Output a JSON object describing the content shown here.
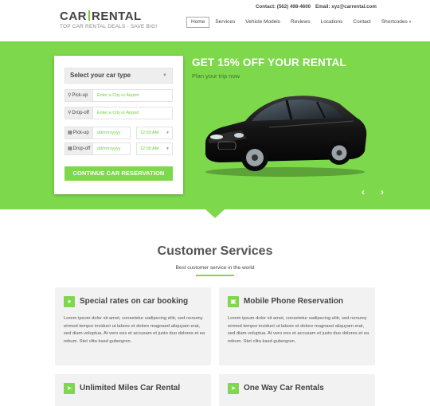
{
  "brand": {
    "logo_left": "CAR",
    "logo_right": "RENTAL",
    "tagline": "TOP CAR RENTAL DEALS - SAVE BIG!"
  },
  "contact": {
    "phone": "Contact: (562) 498-4600",
    "email": "Email: xyz@carrental.com"
  },
  "nav": {
    "items": [
      "Home",
      "Services",
      "Vehicle Models",
      "Reviews",
      "Locations",
      "Contact",
      "Shortcodes"
    ],
    "active": "Home"
  },
  "form": {
    "select_type": "Select your car type",
    "pickup_label": "Pick-up",
    "dropoff_label": "Drop-off",
    "pickup_location_placeholder": "Enter a City or Airport",
    "dropoff_location_placeholder": "Enter a City or Airport",
    "pickup_date_placeholder": "dd/mm/yyyy",
    "dropoff_date_placeholder": "dd/mm/yyyy",
    "pickup_time": "12:00 AM",
    "dropoff_time": "12:00 AM",
    "submit": "CONTINUE CAR RESERVATION"
  },
  "promo": {
    "title": "GET 15% OFF YOUR RENTAL",
    "subtitle": "Plan your trip now"
  },
  "services": {
    "title": "Customer Services",
    "subtitle": "Best customer service in the world",
    "cards": [
      {
        "title": "Special rates on car booking",
        "icon": "apple-icon",
        "text": "Lorem ipsum dolor sit amet, consetetur sadipscing elitr, sed nonumy eirmod tempor invidunt ut labore et dolore magnaed aliquyam erat, sed diam voluptua. At vero eos et accusam et justo duo dolores et ea rebum. Stet clita kasd gubergren."
      },
      {
        "title": "Mobile Phone Reservation",
        "icon": "gift-icon",
        "text": "Lorem ipsum dolor sit amet, consetetur sadipscing elitr, sed nonumy eirmod tempor invidunt ut labore et dolore magnaed aliquyam erat, sed diam voluptua. At vero eos et accusam et justo duo dolores et ea rebum. Stet clita kasd gubergren."
      },
      {
        "title": "Unlimited Miles Car Rental",
        "icon": "paper-plane-icon",
        "text": ""
      },
      {
        "title": "One Way Car Rentals",
        "icon": "paper-plane-icon",
        "text": ""
      }
    ]
  },
  "colors": {
    "accent": "#7dd84b",
    "accent_dark": "#3d7a22"
  }
}
